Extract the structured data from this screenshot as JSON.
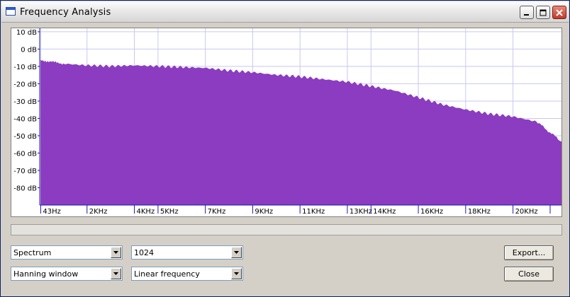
{
  "window": {
    "title": "Frequency Analysis",
    "icons": [
      "window-app-icon",
      "minimize-icon",
      "maximize-icon",
      "close-icon"
    ]
  },
  "chart_data": {
    "type": "area",
    "title": "",
    "xlabel": "",
    "ylabel": "",
    "ylim": [
      -90,
      12
    ],
    "xlim": [
      0,
      22050
    ],
    "y_ticks": [
      10,
      0,
      -10,
      -20,
      -30,
      -40,
      -50,
      -60,
      -70,
      -80
    ],
    "y_tick_labels": [
      "10 dB",
      "0 dB",
      "-10 dB",
      "-20 dB",
      "-30 dB",
      "-40 dB",
      "-50 dB",
      "-60 dB",
      "-70 dB",
      "-80 dB"
    ],
    "x_ticks": [
      43,
      2000,
      4000,
      5000,
      7000,
      9000,
      11000,
      13000,
      14000,
      16000,
      18000,
      20000
    ],
    "x_tick_labels": [
      "43Hz",
      "2KHz",
      "4KHz",
      "5KHz",
      "7KHz",
      "9KHz",
      "11KHz",
      "13KHz",
      "14KHz",
      "16KHz",
      "18KHz",
      "20KHz"
    ],
    "grid": true,
    "fill_color": "#8b3cc0",
    "x": [
      43,
      1000,
      2000,
      3000,
      4000,
      5000,
      6000,
      7000,
      8000,
      9000,
      10000,
      11000,
      12000,
      13000,
      14000,
      15000,
      16000,
      17000,
      18000,
      19000,
      20000,
      21000,
      22050
    ],
    "values": [
      -6.5,
      -8.5,
      -9.5,
      -10,
      -9.5,
      -10,
      -10.5,
      -11,
      -12.5,
      -13.5,
      -15,
      -16,
      -17.5,
      -19,
      -21.5,
      -24,
      -28,
      -32,
      -35,
      -37.5,
      -39,
      -42,
      -53.5
    ]
  },
  "controls": {
    "progress": 0,
    "spectrum_select": "Spectrum",
    "size_select": "1024",
    "window_select": "Hanning window",
    "axis_select": "Linear frequency",
    "export_label": "Export...",
    "close_label": "Close"
  }
}
